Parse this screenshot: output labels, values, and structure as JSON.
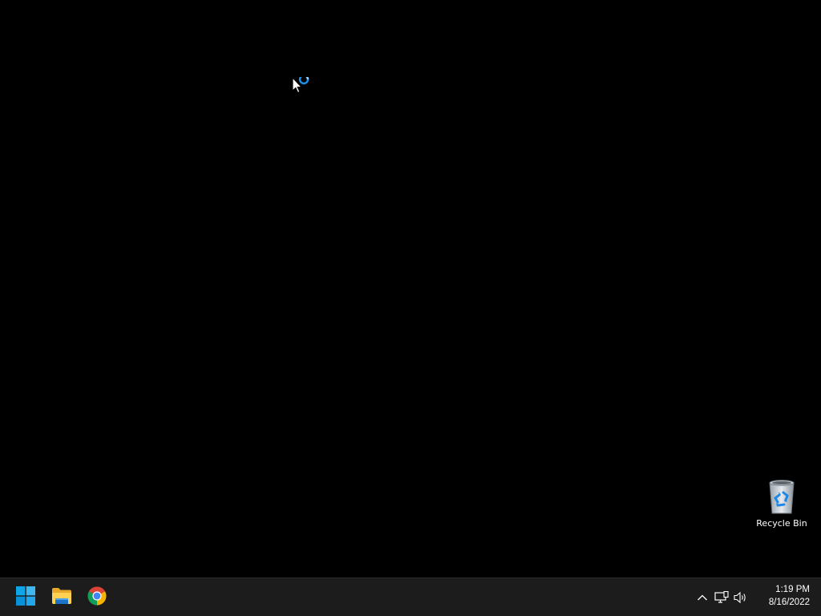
{
  "desktop": {
    "icons": [
      {
        "label": "Recycle Bin",
        "icon": "recycle-bin-icon"
      }
    ]
  },
  "cursor": {
    "state": "working-in-background",
    "icon": "arrow-busy-cursor-icon",
    "accent": "#1e90e8"
  },
  "taskbar": {
    "background": "#1c1c1c",
    "pinned": [
      {
        "name": "Start",
        "icon": "windows-start-icon",
        "color": "#0ea5e9"
      },
      {
        "name": "File Explorer",
        "icon": "folder-icon",
        "color": "#f7c948"
      },
      {
        "name": "Google Chrome",
        "icon": "chrome-icon",
        "color": "#db4437"
      }
    ],
    "tray": {
      "icons": [
        "chevron-up-icon",
        "network-icon",
        "volume-icon"
      ]
    },
    "clock": {
      "time": "1:19 PM",
      "date": "8/16/2022"
    }
  }
}
